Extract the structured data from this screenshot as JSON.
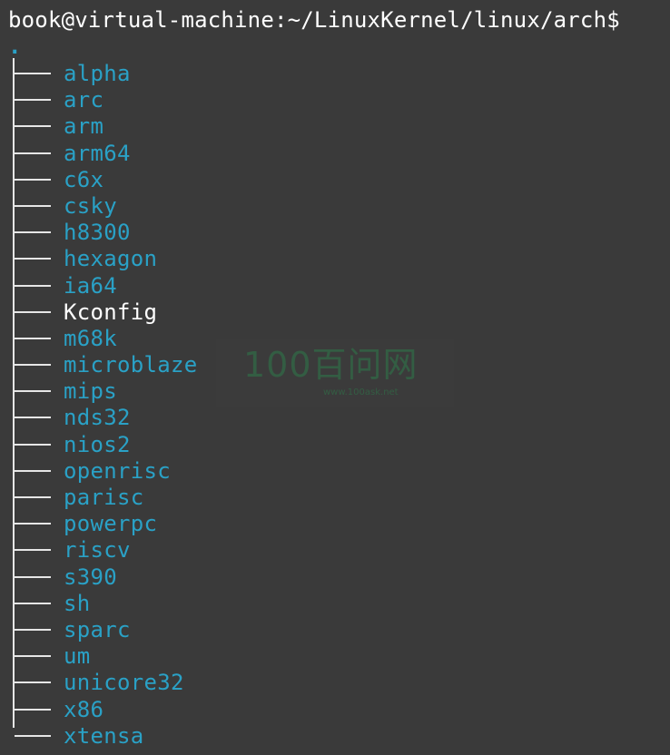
{
  "terminal": {
    "prompt": "book@virtual-machine:~/LinuxKernel/linux/arch$",
    "tree_root": ".",
    "colors": {
      "background": "#3a3a3a",
      "directory": "#2aa1c6",
      "file": "#ffffff",
      "tree_lines": "#e6e6e6"
    },
    "entries": [
      {
        "name": "alpha",
        "type": "directory"
      },
      {
        "name": "arc",
        "type": "directory"
      },
      {
        "name": "arm",
        "type": "directory"
      },
      {
        "name": "arm64",
        "type": "directory"
      },
      {
        "name": "c6x",
        "type": "directory"
      },
      {
        "name": "csky",
        "type": "directory"
      },
      {
        "name": "h8300",
        "type": "directory"
      },
      {
        "name": "hexagon",
        "type": "directory"
      },
      {
        "name": "ia64",
        "type": "directory"
      },
      {
        "name": "Kconfig",
        "type": "file"
      },
      {
        "name": "m68k",
        "type": "directory"
      },
      {
        "name": "microblaze",
        "type": "directory"
      },
      {
        "name": "mips",
        "type": "directory"
      },
      {
        "name": "nds32",
        "type": "directory"
      },
      {
        "name": "nios2",
        "type": "directory"
      },
      {
        "name": "openrisc",
        "type": "directory"
      },
      {
        "name": "parisc",
        "type": "directory"
      },
      {
        "name": "powerpc",
        "type": "directory"
      },
      {
        "name": "riscv",
        "type": "directory"
      },
      {
        "name": "s390",
        "type": "directory"
      },
      {
        "name": "sh",
        "type": "directory"
      },
      {
        "name": "sparc",
        "type": "directory"
      },
      {
        "name": "um",
        "type": "directory"
      },
      {
        "name": "unicore32",
        "type": "directory"
      },
      {
        "name": "x86",
        "type": "directory"
      },
      {
        "name": "xtensa",
        "type": "directory"
      }
    ]
  },
  "watermark": {
    "logo": "100百问网",
    "url": "www.100ask.net"
  }
}
